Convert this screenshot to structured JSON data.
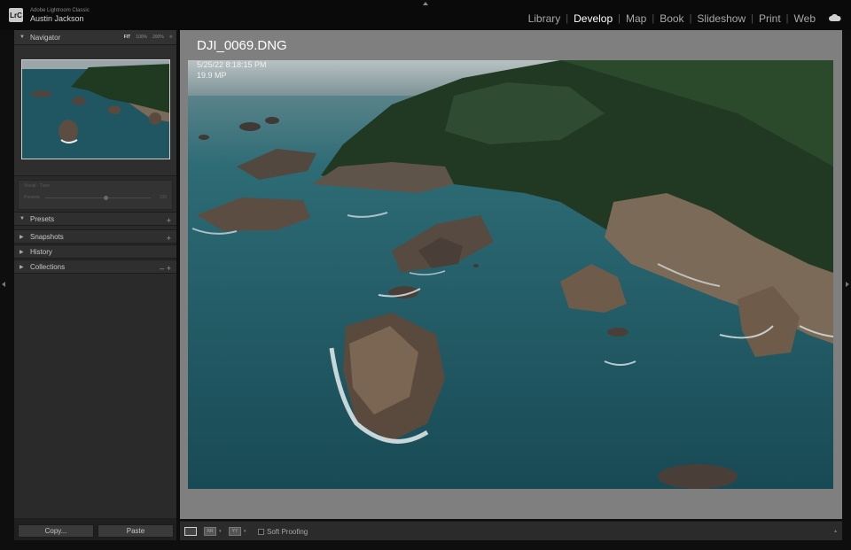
{
  "app": {
    "logo": "LrC",
    "name": "Adobe Lightroom Classic",
    "user": "Austin Jackson"
  },
  "modules": [
    {
      "label": "Library",
      "active": false
    },
    {
      "label": "Develop",
      "active": true
    },
    {
      "label": "Map",
      "active": false
    },
    {
      "label": "Book",
      "active": false
    },
    {
      "label": "Slideshow",
      "active": false
    },
    {
      "label": "Print",
      "active": false
    },
    {
      "label": "Web",
      "active": false
    }
  ],
  "left_panel": {
    "navigator": {
      "title": "Navigator",
      "zoom_fit": "FIT",
      "zoom_fill": "100%",
      "zoom_2": "200%",
      "zoom_more": "≑"
    },
    "slider_box": {
      "title": "Visual · Tune",
      "label": "Preview",
      "value": "100",
      "level": 0.57
    },
    "sections": [
      {
        "label": "Presets",
        "expanded": true,
        "action": "+"
      },
      {
        "label": "Snapshots",
        "expanded": false,
        "action": "+"
      },
      {
        "label": "History",
        "expanded": false,
        "action": ""
      },
      {
        "label": "Collections",
        "expanded": false,
        "action": "– +"
      }
    ],
    "buttons": {
      "copy": "Copy...",
      "paste": "Paste"
    }
  },
  "photo_info": {
    "filename": "DJI_0069.DNG",
    "datetime": "5/25/22 8:18:15 PM",
    "megapixels": "19.9 MP"
  },
  "toolbar": {
    "soft_proofing_label": "Soft Proofing",
    "ba_1": "RR",
    "ba_2": "YY",
    "soft_proofing_checked": false
  },
  "colors": {
    "active_module": "#ffffff",
    "panel_bg": "#2a2a2a",
    "canvas_bg": "#7f7f7f"
  },
  "icons": {
    "cloud": "cloud-sync-icon",
    "disclosure_open": "triangle-down-icon",
    "disclosure_closed": "triangle-right-icon"
  }
}
